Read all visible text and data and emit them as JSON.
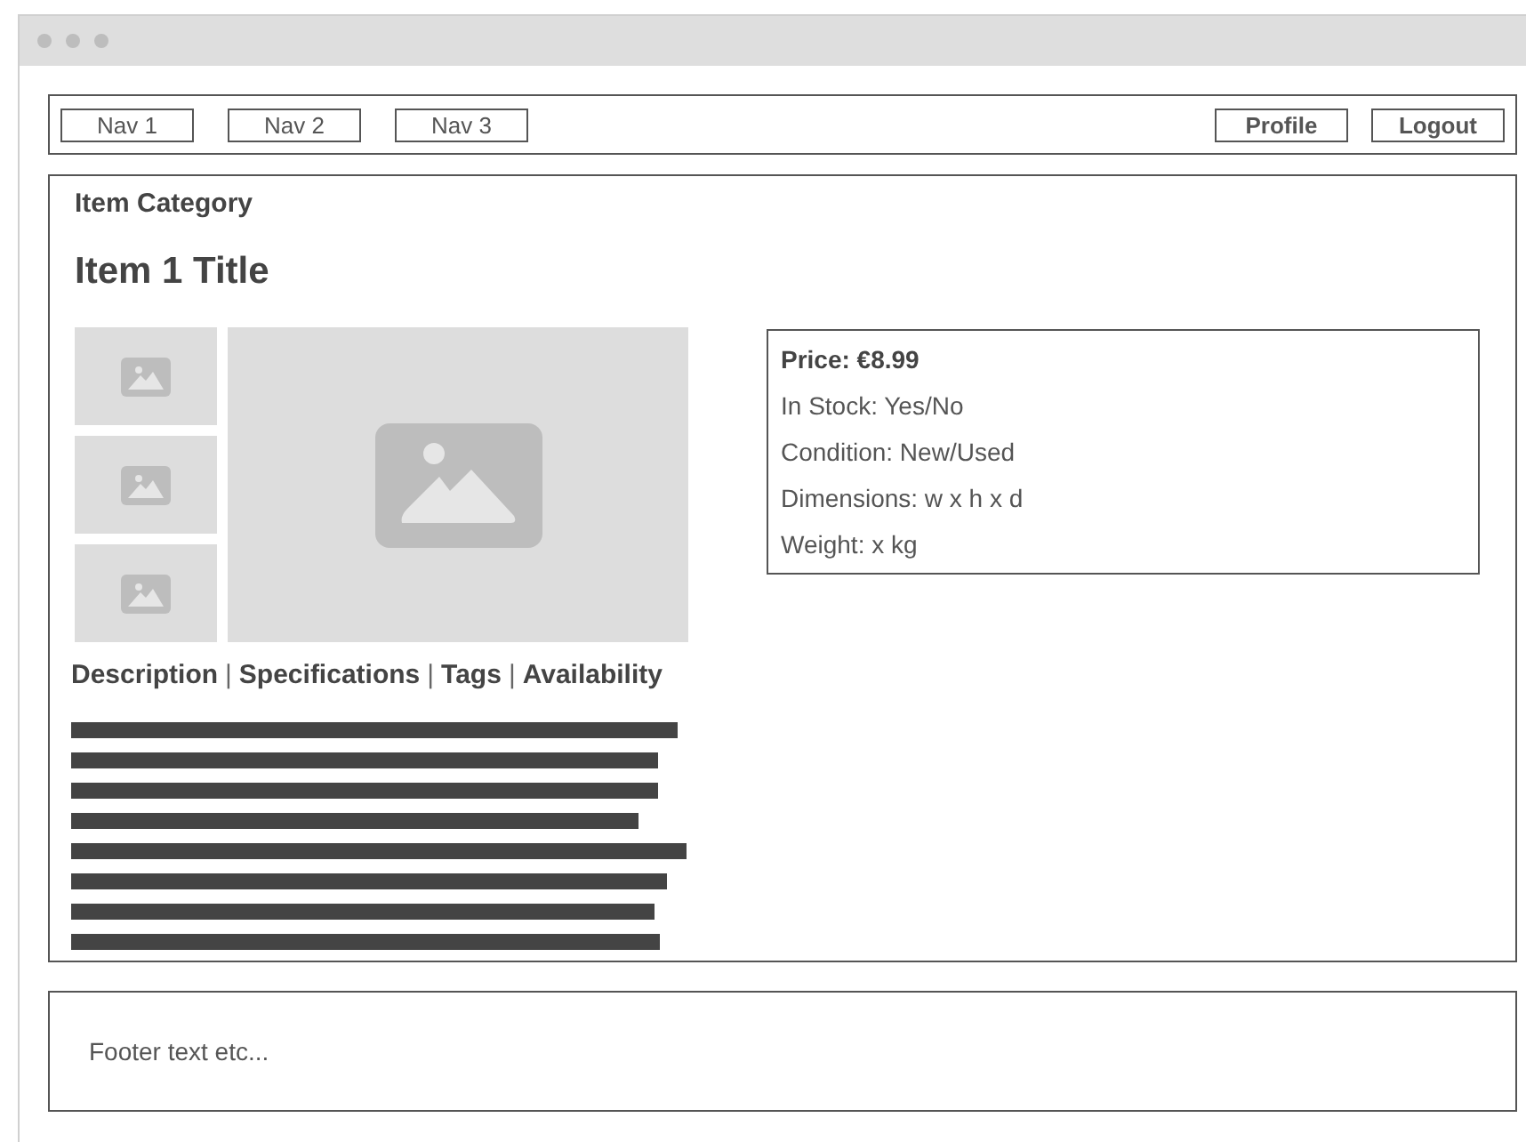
{
  "nav": {
    "left": [
      {
        "label": "Nav 1"
      },
      {
        "label": "Nav 2"
      },
      {
        "label": "Nav 3"
      }
    ],
    "right": [
      {
        "label": "Profile"
      },
      {
        "label": "Logout"
      }
    ]
  },
  "item": {
    "category": "Item Category",
    "title": "Item 1 Title",
    "tabs": [
      {
        "label": "Description",
        "separator": "|"
      },
      {
        "label": "Specifications",
        "separator": "|"
      },
      {
        "label": "Tags",
        "separator": "|"
      },
      {
        "label": "Availability"
      }
    ],
    "price": "Price: €8.99",
    "details": [
      "In Stock: Yes/No",
      "Condition: New/Used",
      "Dimensions: w x h x d",
      "Weight: x kg"
    ]
  },
  "footer": {
    "text": "Footer text etc..."
  }
}
